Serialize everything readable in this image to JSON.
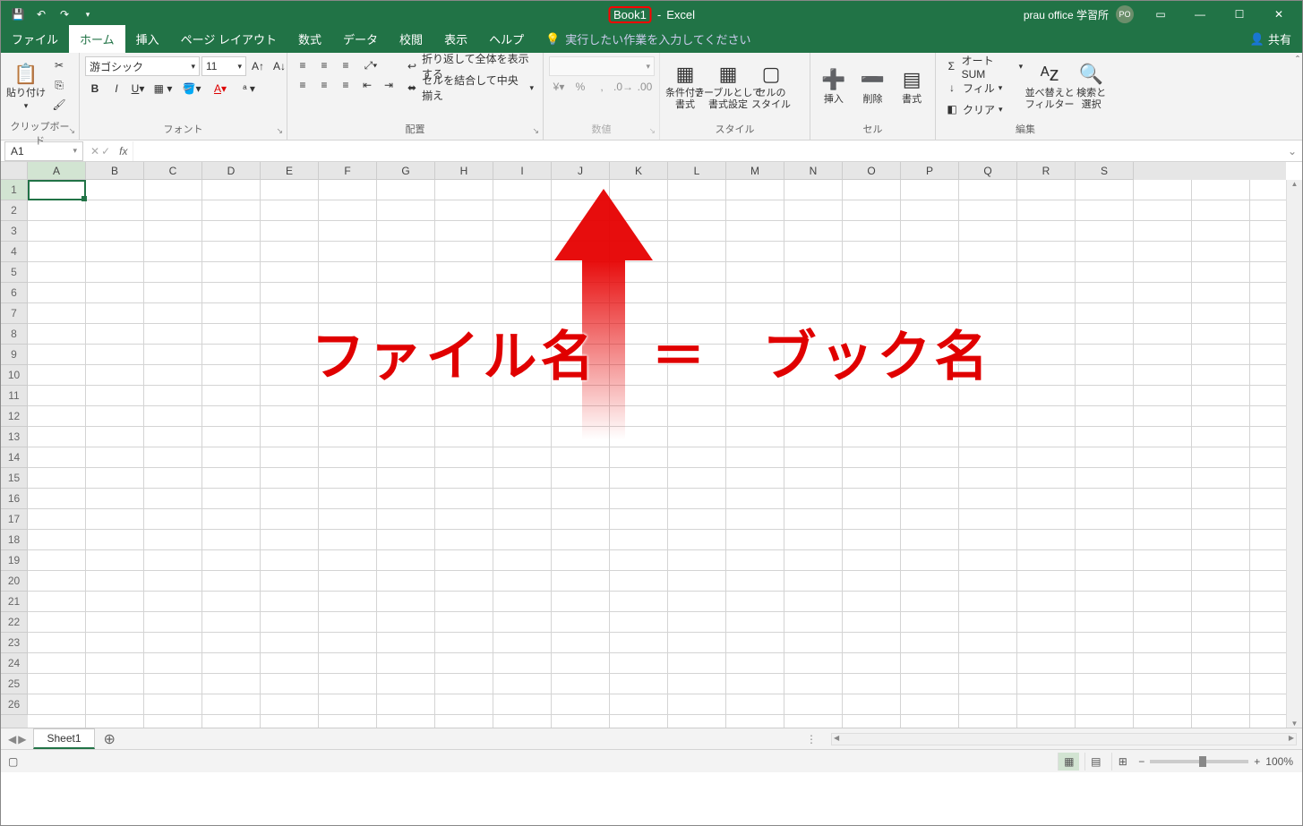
{
  "titlebar": {
    "book_name": "Book1",
    "app_name": "Excel",
    "user": "prau office 学習所",
    "avatar": "PO"
  },
  "tabs": {
    "file": "ファイル",
    "home": "ホーム",
    "insert": "挿入",
    "pagelayout": "ページ レイアウト",
    "formulas": "数式",
    "data": "データ",
    "review": "校閲",
    "view": "表示",
    "help": "ヘルプ",
    "tellme": "実行したい作業を入力してください",
    "share": "共有"
  },
  "ribbon": {
    "clipboard": {
      "paste": "貼り付け",
      "label": "クリップボード"
    },
    "font": {
      "name": "游ゴシック",
      "size": "11",
      "label": "フォント"
    },
    "align": {
      "wrap": "折り返して全体を表示する",
      "merge": "セルを結合して中央揃え",
      "label": "配置"
    },
    "number": {
      "label": "数値"
    },
    "styles": {
      "cond": "条件付き\n書式",
      "table": "テーブルとして\n書式設定",
      "cell": "セルの\nスタイル",
      "label": "スタイル"
    },
    "cells": {
      "insert": "挿入",
      "delete": "削除",
      "format": "書式",
      "label": "セル"
    },
    "editing": {
      "sum": "オート SUM",
      "fill": "フィル",
      "clear": "クリア",
      "sort": "並べ替えと\nフィルター",
      "find": "検索と\n選択",
      "label": "編集"
    }
  },
  "namebox": "A1",
  "columns": [
    "A",
    "B",
    "C",
    "D",
    "E",
    "F",
    "G",
    "H",
    "I",
    "J",
    "K",
    "L",
    "M",
    "N",
    "O",
    "P",
    "Q",
    "R",
    "S"
  ],
  "rows": 26,
  "sheet": {
    "name": "Sheet1"
  },
  "annotation": {
    "left": "ファイル名",
    "eq": "＝",
    "right": "ブック名"
  },
  "status": {
    "zoom": "100%"
  }
}
